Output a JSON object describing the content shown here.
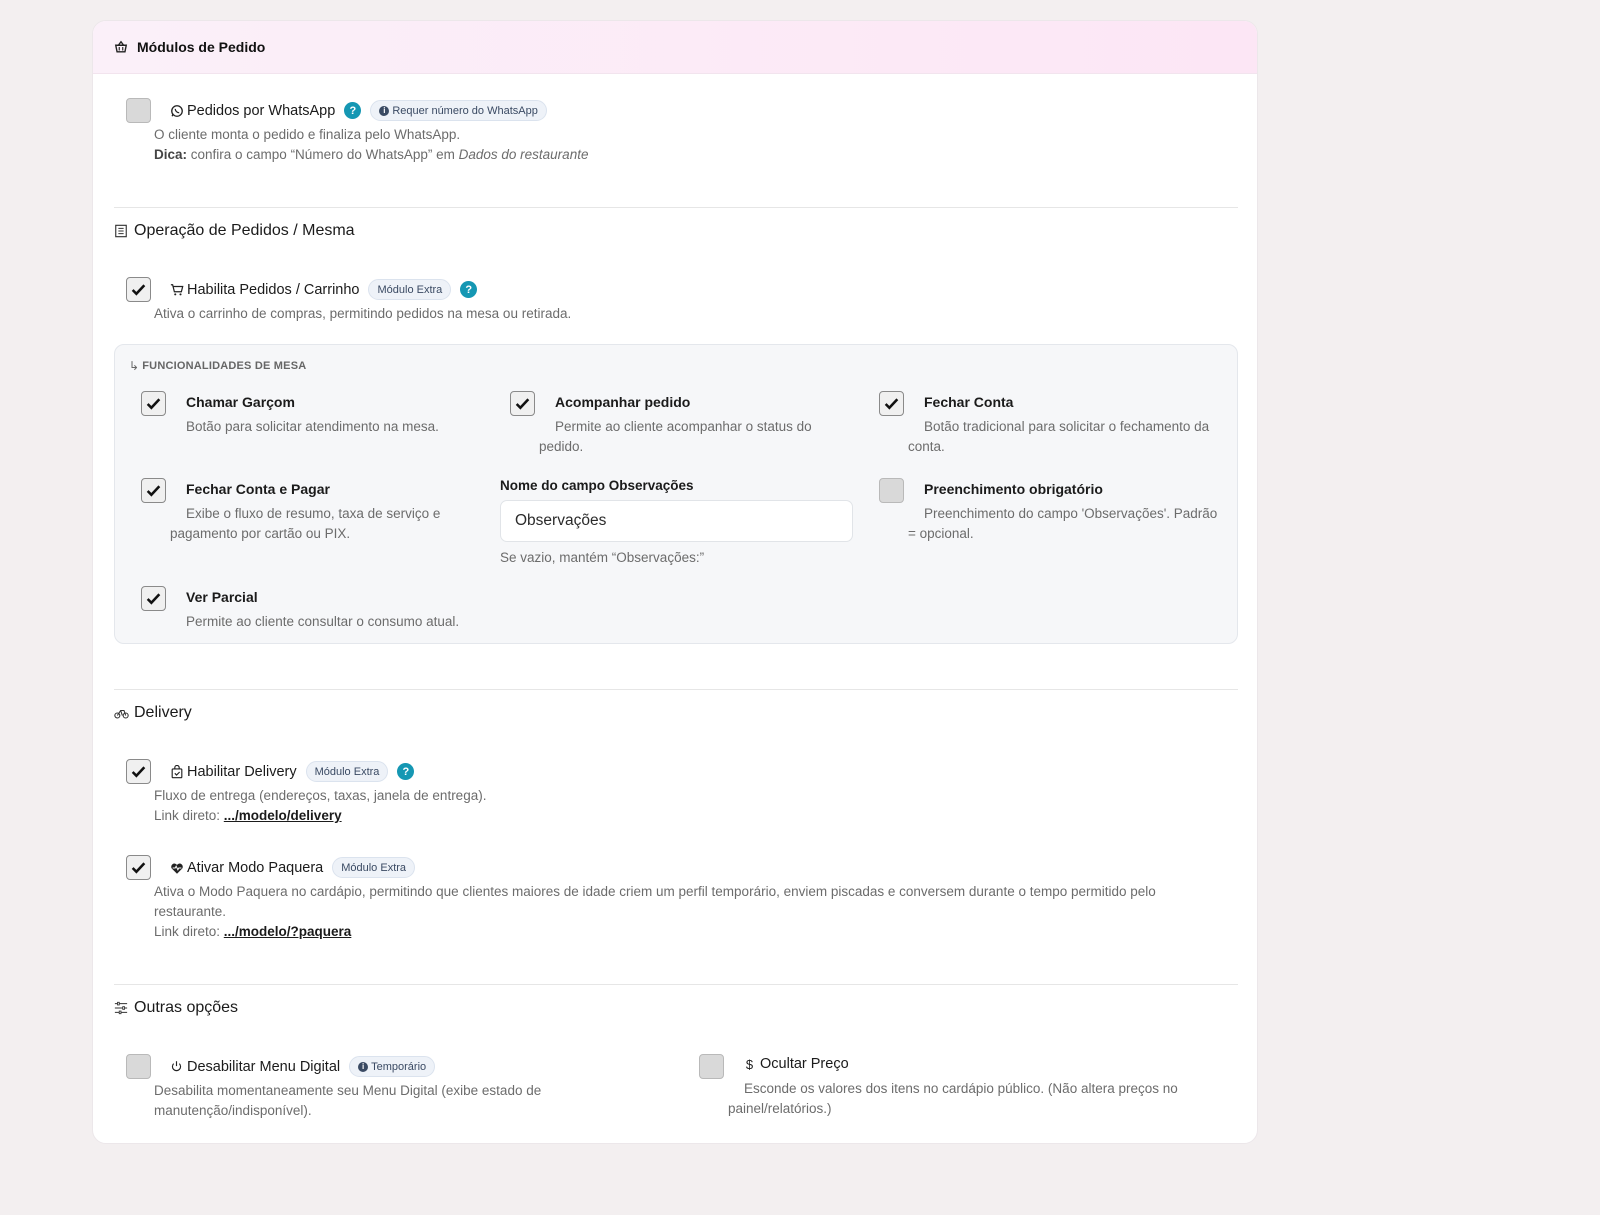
{
  "header": {
    "title": "Módulos de Pedido",
    "icon": "basket-icon"
  },
  "whatsapp": {
    "title": "Pedidos por WhatsApp",
    "badge": "Requer número do WhatsApp",
    "desc": "O cliente monta o pedido e finaliza pelo WhatsApp.",
    "tip_label": "Dica:",
    "tip_text": " confira o campo “Número do WhatsApp” em ",
    "tip_em": "Dados do restaurante",
    "checked": false
  },
  "operacao": {
    "section_title": "Operação de Pedidos / Mesma",
    "carrinho": {
      "title": "Habilita Pedidos / Carrinho",
      "badge": "Módulo Extra",
      "desc": "Ativa o carrinho de compras, permitindo pedidos na mesa ou retirada.",
      "checked": true
    },
    "mesa": {
      "label": "FUNCIONALIDADES DE MESA",
      "chamar": {
        "title": "Chamar Garçom",
        "desc": "Botão para solicitar atendimento na mesa.",
        "checked": true
      },
      "acompanhar": {
        "title": "Acompanhar pedido",
        "desc": "Permite ao cliente acompanhar o status do pedido.",
        "checked": true
      },
      "fechar": {
        "title": "Fechar Conta",
        "desc": "Botão tradicional para solicitar o fechamento da conta.",
        "checked": true
      },
      "fechar_pagar": {
        "title": "Fechar Conta e Pagar",
        "desc": "Exibe o fluxo de resumo, taxa de serviço e pagamento por cartão ou PIX.",
        "checked": true
      },
      "obs_field": {
        "label": "Nome do campo Observações",
        "value": "Observações",
        "help": "Se vazio, mantém “Observações:”"
      },
      "obrigatorio": {
        "title": "Preenchimento obrigatório",
        "desc": "Preenchimento do campo 'Observações'. Padrão = opcional.",
        "checked": false
      },
      "parcial": {
        "title": "Ver Parcial",
        "desc": "Permite ao cliente consultar o consumo atual.",
        "checked": true
      }
    }
  },
  "delivery": {
    "section_title": "Delivery",
    "habilitar": {
      "title": "Habilitar Delivery",
      "badge": "Módulo Extra",
      "desc": "Fluxo de entrega (endereços, taxas, janela de entrega).",
      "link_label": "Link direto: ",
      "link": ".../modelo/delivery",
      "checked": true
    },
    "paquera": {
      "title": "Ativar Modo Paquera",
      "badge": "Módulo Extra",
      "desc": "Ativa o Modo Paquera no cardápio, permitindo que clientes maiores de idade criem um perfil temporário, enviem piscadas e conversem durante o tempo permitido pelo restaurante.",
      "link_label": "Link direto: ",
      "link": ".../modelo/?paquera",
      "checked": true
    }
  },
  "outras": {
    "section_title": "Outras opções",
    "desabilitar": {
      "title": "Desabilitar Menu Digital",
      "badge": "Temporário",
      "desc": "Desabilita momentaneamente seu Menu Digital (exibe estado de manutenção/indisponível).",
      "checked": false
    },
    "ocultar": {
      "title": "Ocultar Preço",
      "desc": "Esconde os valores dos itens no cardápio público. (Não altera preços no painel/relatórios.)",
      "checked": false
    }
  },
  "help_glyph": "?",
  "info_glyph": "i",
  "colors": {
    "help": "#1597b3",
    "header_bg": "#fce6f5",
    "page_bg": "#f3eff0"
  }
}
